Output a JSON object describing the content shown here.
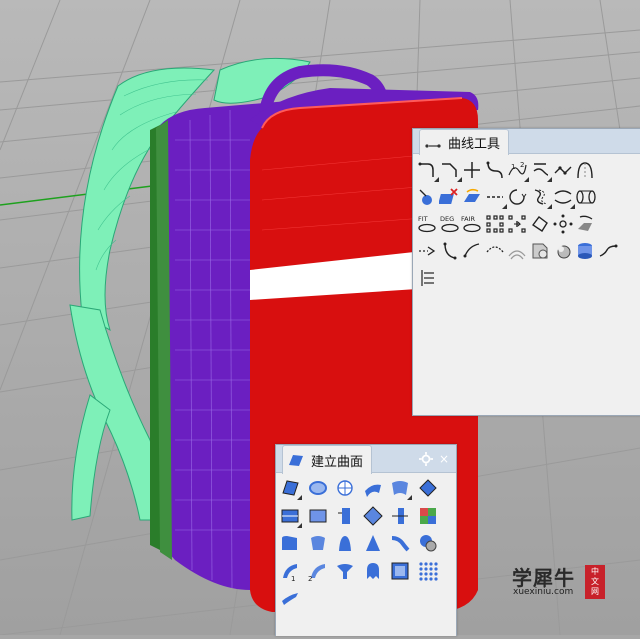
{
  "curve_panel": {
    "title": "曲线工具",
    "tool_labels": {
      "fit": "FIT",
      "deg": "DEG",
      "fair": "FAIR",
      "num1": "1",
      "num2": "2"
    }
  },
  "surface_panel": {
    "title": "建立曲面",
    "close_glyph": "×",
    "label_1": "1",
    "label_2": "2"
  },
  "watermark": {
    "title": "学犀牛",
    "url": "xuexiniu.com",
    "seal": [
      "中",
      "文",
      "网"
    ]
  },
  "colors": {
    "viewport_bg": "#a7a7a7",
    "backpack_front": "#d80f0f",
    "backpack_side": "#6b1fc1",
    "straps": "#7ef0b8",
    "panel_header": "#cfdbe9"
  }
}
